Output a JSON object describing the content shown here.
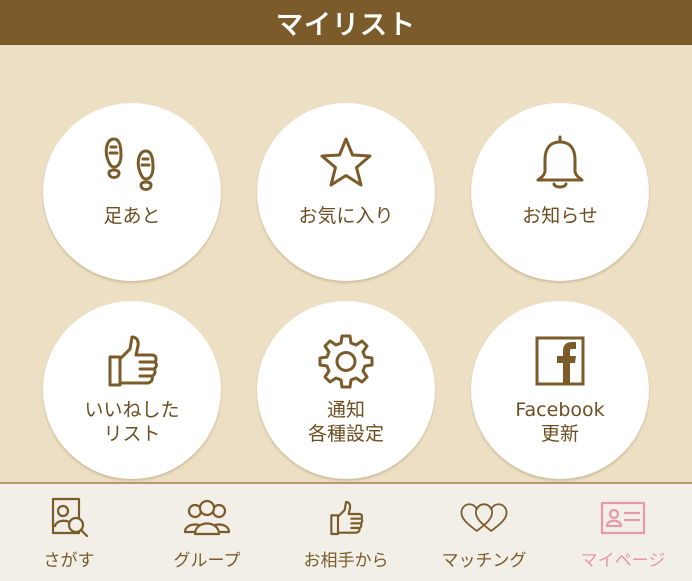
{
  "header": {
    "title": "マイリスト"
  },
  "grid": {
    "items": [
      {
        "icon": "footprints-icon",
        "label_lines": [
          "足あと"
        ]
      },
      {
        "icon": "star-icon",
        "label_lines": [
          "お気に入り"
        ]
      },
      {
        "icon": "bell-icon",
        "label_lines": [
          "お知らせ"
        ]
      },
      {
        "icon": "thumbs-up-icon",
        "label_lines": [
          "いいねした",
          "リスト"
        ]
      },
      {
        "icon": "gear-icon",
        "label_lines": [
          "通知",
          "各種設定"
        ]
      },
      {
        "icon": "facebook-icon",
        "label_lines": [
          "Facebook",
          "更新"
        ]
      }
    ]
  },
  "tabbar": {
    "tabs": [
      {
        "icon": "search-profile-icon",
        "label": "さがす",
        "active": false
      },
      {
        "icon": "group-icon",
        "label": "グループ",
        "active": false
      },
      {
        "icon": "thumbs-up-icon",
        "label": "お相手から",
        "active": false
      },
      {
        "icon": "hearts-icon",
        "label": "マッチング",
        "active": false
      },
      {
        "icon": "id-card-icon",
        "label": "マイページ",
        "active": true
      }
    ]
  },
  "colors": {
    "header_bg": "#7a5b29",
    "background": "#ecdfc3",
    "accent_text": "#6b4e22",
    "active_tab": "#e69aa3",
    "tabbar_bg": "#f2efe9"
  }
}
